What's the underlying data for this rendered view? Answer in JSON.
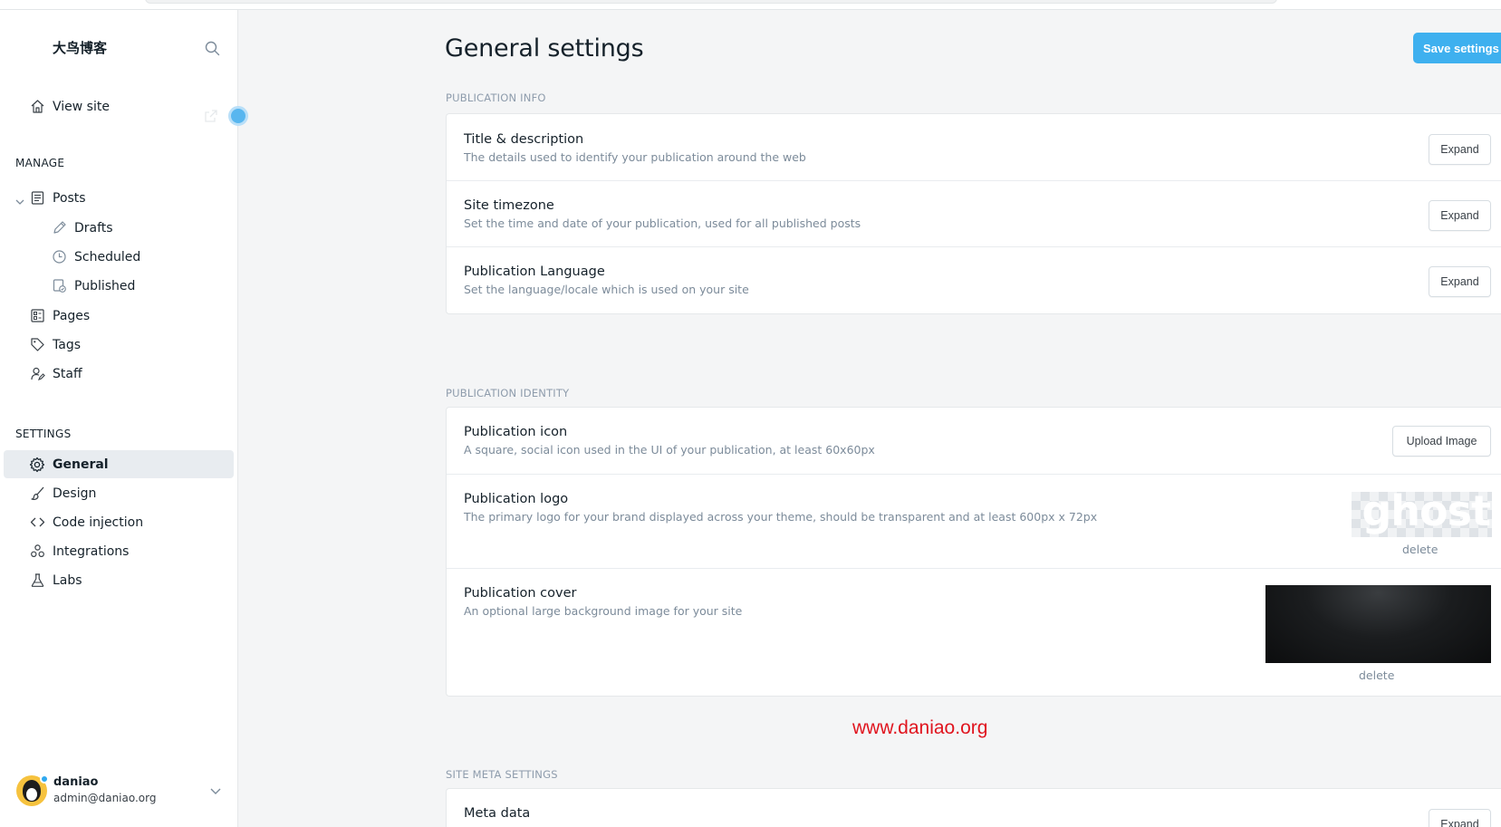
{
  "sidebar": {
    "brand": "大鸟博客",
    "view_site": "View site",
    "manage_label": "MANAGE",
    "manage_items": [
      "Posts",
      "Drafts",
      "Scheduled",
      "Published",
      "Pages",
      "Tags",
      "Staff"
    ],
    "settings_label": "SETTINGS",
    "settings_items": [
      "General",
      "Design",
      "Code injection",
      "Integrations",
      "Labs"
    ],
    "active_item": "General",
    "user": {
      "name": "daniao",
      "email": "admin@daniao.org"
    }
  },
  "header": {
    "title": "General settings",
    "save_label": "Save settings"
  },
  "publication_info": {
    "group_title": "PUBLICATION INFO",
    "rows": [
      {
        "title": "Title & description",
        "desc": "The details used to identify your publication around the web",
        "action": "Expand"
      },
      {
        "title": "Site timezone",
        "desc": "Set the time and date of your publication, used for all published posts",
        "action": "Expand"
      },
      {
        "title": "Publication Language",
        "desc": "Set the language/locale which is used on your site",
        "action": "Expand"
      }
    ]
  },
  "publication_identity": {
    "group_title": "PUBLICATION IDENTITY",
    "icon": {
      "title": "Publication icon",
      "desc": "A square, social icon used in the UI of your publication, at least 60x60px",
      "action": "Upload Image"
    },
    "logo": {
      "title": "Publication logo",
      "desc": "The primary logo for your brand displayed across your theme, should be transparent and at least 600px x 72px",
      "logo_text": "ghost",
      "delete_label": "delete"
    },
    "cover": {
      "title": "Publication cover",
      "desc": "An optional large background image for your site",
      "delete_label": "delete"
    }
  },
  "watermark": "www.daniao.org",
  "site_meta": {
    "group_title": "SITE META SETTINGS",
    "rows": [
      {
        "title": "Meta data",
        "action": "Expand"
      }
    ]
  },
  "colors": {
    "accent": "#3eb0ef",
    "sidebar_active_bg": "#e8ecf0",
    "watermark": "#e0141e"
  }
}
